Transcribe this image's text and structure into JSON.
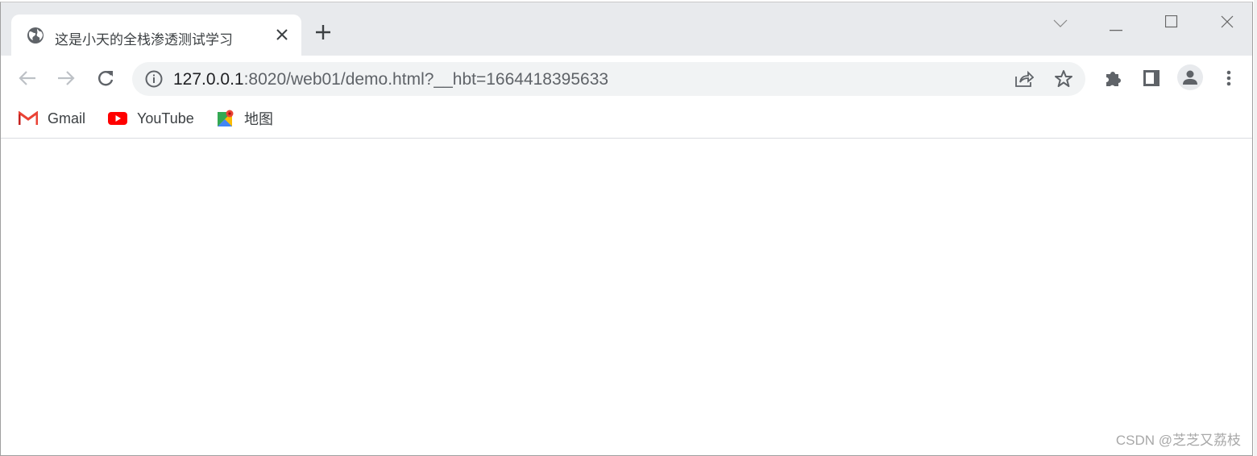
{
  "tab": {
    "title": "这是小天的全栈渗透测试学习",
    "favicon": "globe-icon"
  },
  "window_controls": [
    "tab-search",
    "minimize",
    "maximize",
    "close"
  ],
  "address_bar": {
    "host": "127.0.0.1",
    "rest": ":8020/web01/demo.html?__hbt=1664418395633"
  },
  "bookmarks": [
    {
      "label": "Gmail",
      "icon": "gmail-icon"
    },
    {
      "label": "YouTube",
      "icon": "youtube-icon"
    },
    {
      "label": "地图",
      "icon": "maps-icon"
    }
  ],
  "watermark": "CSDN @芝芝又荔枝"
}
